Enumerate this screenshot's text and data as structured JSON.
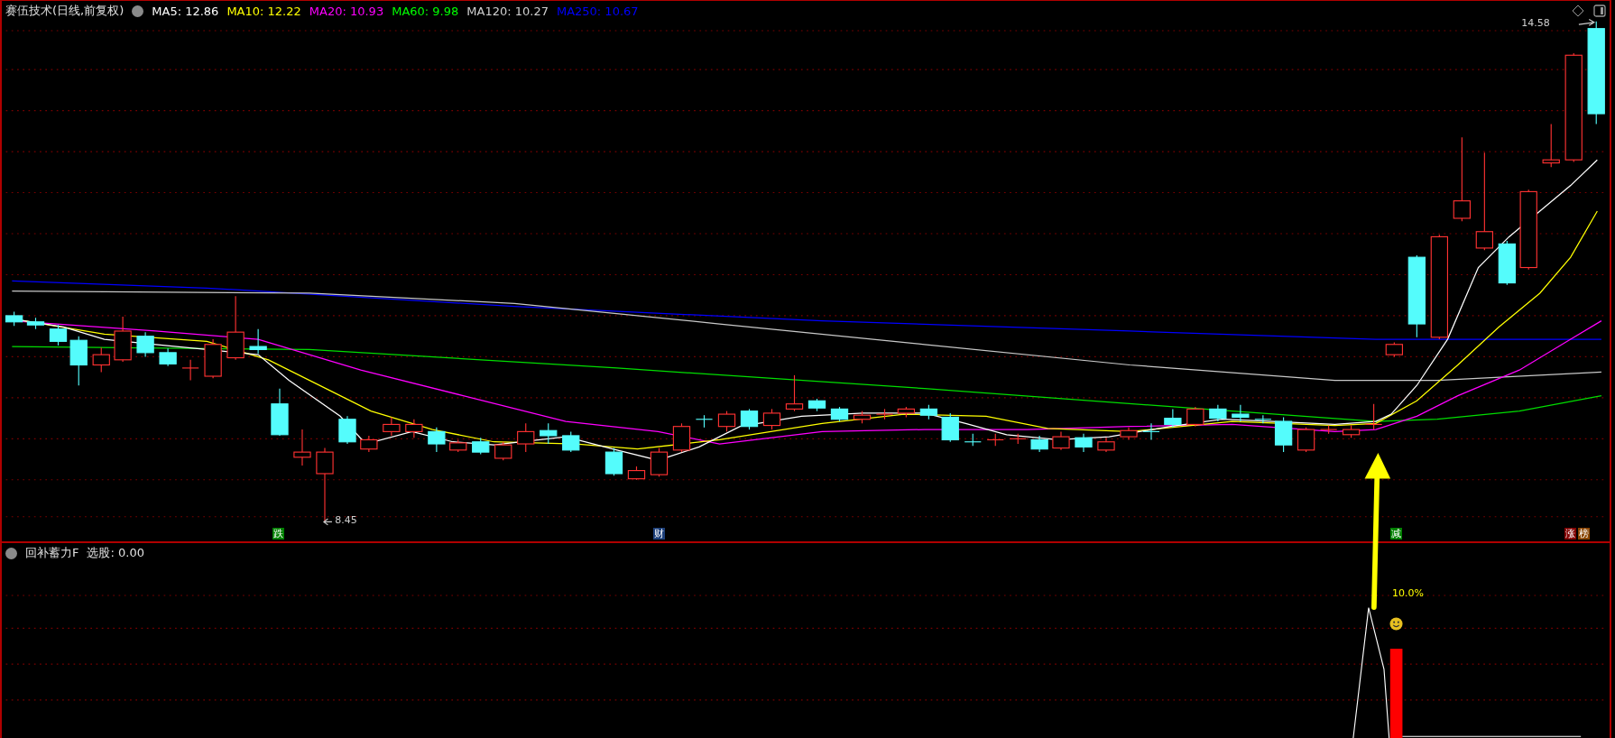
{
  "main_chart": {
    "title": "赛伍技术(日线,前复权)",
    "indicators": [
      {
        "label": "MA5: 12.86",
        "color": "#ffffff"
      },
      {
        "label": "MA10: 12.22",
        "color": "#ffff00"
      },
      {
        "label": "MA20: 10.93",
        "color": "#ff00ff"
      },
      {
        "label": "MA60: 9.98",
        "color": "#00ff00"
      },
      {
        "label": "MA120: 10.27",
        "color": "#d0d0d0"
      },
      {
        "label": "MA250: 10.67",
        "color": "#0000ff"
      }
    ],
    "high_label": "14.58",
    "low_label": "8.45",
    "signals": [
      {
        "text": "跌",
        "color": "#008000"
      },
      {
        "text": "财",
        "color": "#1c3f7a"
      },
      {
        "text": "减",
        "color": "#008000"
      },
      {
        "text": "涨",
        "color": "#800000"
      },
      {
        "text": "榜",
        "color": "#8a4500"
      }
    ]
  },
  "sub_chart": {
    "title": "回补蓄力F",
    "reading": "选股: 0.00",
    "percent_label": "10.0%"
  }
}
